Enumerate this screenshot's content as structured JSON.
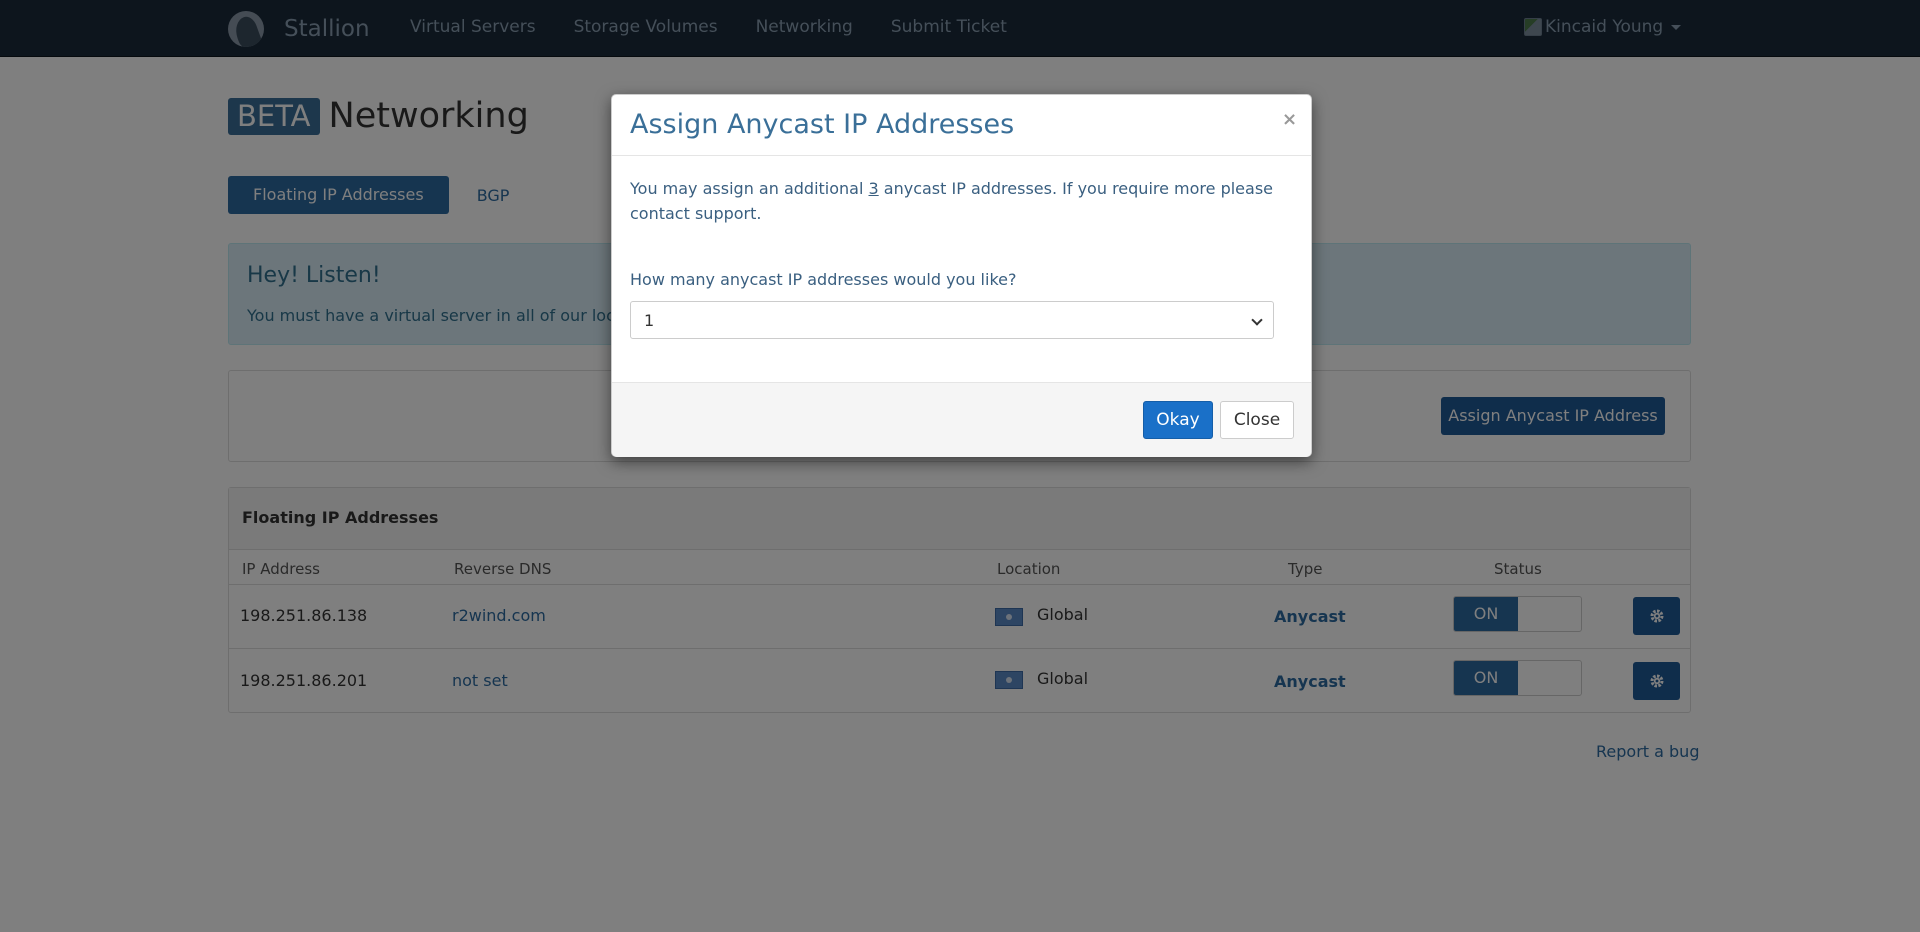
{
  "navbar": {
    "brand": "Stallion",
    "links": [
      "Virtual Servers",
      "Storage Volumes",
      "Networking",
      "Submit Ticket"
    ],
    "user": "Kincaid Young"
  },
  "page": {
    "badge": "BETA",
    "title": "Networking",
    "tabs": [
      "Floating IP Addresses",
      "BGP"
    ]
  },
  "alert": {
    "title": "Hey! Listen!",
    "text": "You must have a virtual server in all of our locati"
  },
  "actions": {
    "assign_label": "Assign Anycast IP Address"
  },
  "table": {
    "title": "Floating IP Addresses",
    "columns": [
      "IP Address",
      "Reverse DNS",
      "Location",
      "Type",
      "Status"
    ],
    "rows": [
      {
        "ip": "198.251.86.138",
        "dns": "r2wind.com",
        "location": "Global",
        "type": "Anycast",
        "status": "ON"
      },
      {
        "ip": "198.251.86.201",
        "dns": "not set",
        "location": "Global",
        "type": "Anycast",
        "status": "ON"
      }
    ]
  },
  "footer": {
    "report_bug": "Report a bug"
  },
  "modal": {
    "title": "Assign Anycast IP Addresses",
    "close_symbol": "×",
    "text_before": "You may assign an additional ",
    "count": "3",
    "text_after": " anycast IP addresses. If you require more please contact support.",
    "question": "How many anycast IP addresses would you like?",
    "selected": "1",
    "okay_label": "Okay",
    "close_label": "Close"
  },
  "colors": {
    "navbar": "#1b2b3a",
    "primary": "#2c6aa0",
    "okay": "#1a70c8"
  }
}
